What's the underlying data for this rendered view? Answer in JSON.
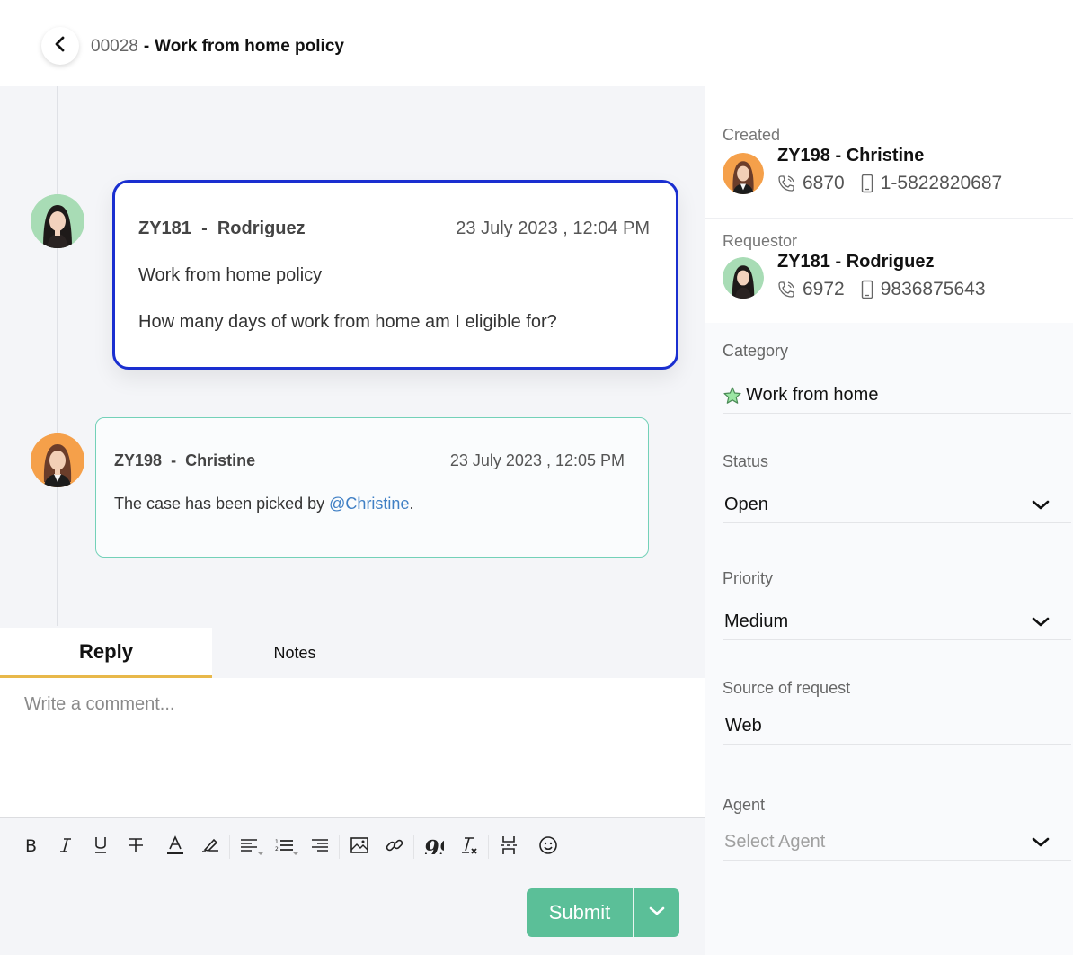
{
  "header": {
    "back_icon": "chevron-left-icon",
    "case_number": "00028",
    "separator": "-",
    "case_title": "Work from home policy"
  },
  "timeline": [
    {
      "author_id": "ZY181",
      "separator": "-",
      "author_name": "Rodriguez",
      "timestamp": "23 July 2023 , 12:04 PM",
      "subject": "Work from home policy",
      "body": "How many days of work from home am I eligible for?",
      "avatar_bg": "#a8dcb5",
      "border_color": "#1a2fd0"
    },
    {
      "author_id": "ZY198",
      "separator": "-",
      "author_name": "Christine",
      "timestamp": "23 July 2023 , 12:05 PM",
      "body_prefix": "The case has been picked by ",
      "mention": "@Christine",
      "body_suffix": ".",
      "avatar_bg": "#f5a04a",
      "border_color": "#73d1b8"
    }
  ],
  "composer": {
    "tabs": [
      {
        "label": "Reply",
        "active": true
      },
      {
        "label": "Notes",
        "active": false
      }
    ],
    "placeholder": "Write a comment...",
    "value": "",
    "toolbar": [
      "bold-icon",
      "italic-icon",
      "underline-icon",
      "strikethrough-icon",
      "font-color-icon",
      "highlight-icon",
      "align-icon",
      "ordered-list-icon",
      "indent-icon",
      "image-icon",
      "link-icon",
      "quote-icon",
      "clear-format-icon",
      "page-break-icon",
      "emoji-icon"
    ],
    "submit_label": "Submit",
    "accent_color": "#5bbf98",
    "active_tab_color": "#e8b84a"
  },
  "sidebar": {
    "created": {
      "label": "Created",
      "name": "ZY198 - Christine",
      "extension": "6870",
      "mobile": "1-5822820687"
    },
    "requestor": {
      "label": "Requestor",
      "name": "ZY181 - Rodriguez",
      "extension": "6972",
      "mobile": "9836875643"
    },
    "category": {
      "label": "Category",
      "value": "Work from home",
      "icon": "star-icon"
    },
    "status": {
      "label": "Status",
      "value": "Open"
    },
    "priority": {
      "label": "Priority",
      "value": "Medium"
    },
    "source": {
      "label": "Source of request",
      "value": "Web"
    },
    "agent": {
      "label": "Agent",
      "placeholder": "Select Agent"
    }
  }
}
